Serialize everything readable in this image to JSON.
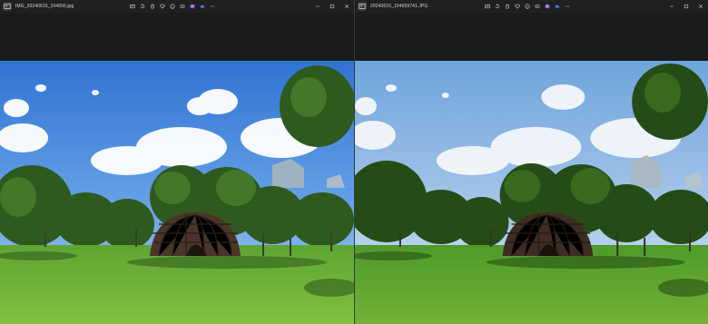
{
  "windows": [
    {
      "file_name": "IMG_20240616_104656.jpg",
      "toolbar_icons": [
        "edit-icon",
        "rotate-icon",
        "delete-icon",
        "favorite-icon",
        "info-icon",
        "share-icon",
        "ai-edit-icon",
        "cloud-icon",
        "more-icon"
      ],
      "controls": [
        "minimize-icon",
        "maximize-icon",
        "close-icon"
      ],
      "photo_tint": "#3b7fd6"
    },
    {
      "file_name": "20240616_104659741.JPG",
      "toolbar_icons": [
        "edit-icon",
        "rotate-icon",
        "delete-icon",
        "favorite-icon",
        "info-icon",
        "share-icon",
        "ai-edit-icon",
        "cloud-icon",
        "more-icon"
      ],
      "controls": [
        "minimize-icon",
        "maximize-icon",
        "close-icon"
      ],
      "photo_tint": "#7fb2e6"
    }
  ],
  "colors": {
    "titlebar": "#202020",
    "background": "#1b1b1b",
    "accent_purple": "#8b5cf6",
    "accent_blue": "#3b82f6"
  }
}
